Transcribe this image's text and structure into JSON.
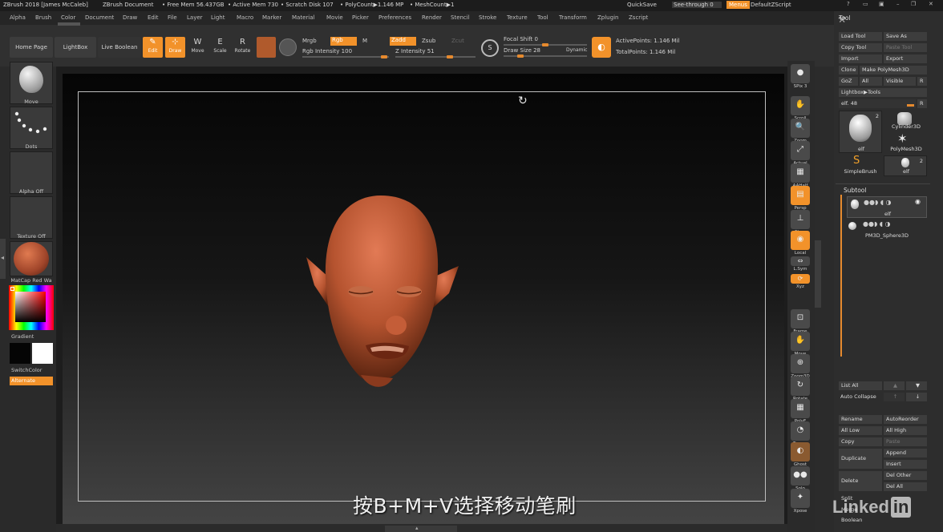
{
  "status_bar": {
    "app_title": "ZBrush 2018 [James McCaleb]",
    "document": "ZBrush Document",
    "free_mem": "• Free Mem 56.437GB",
    "active_mem": "• Active Mem 730",
    "scratch_disk": "• Scratch Disk 107",
    "polycount": "• PolyCount▶1.146 MP",
    "meshcount": "• MeshCount▶1",
    "quicksave": "QuickSave",
    "see_through": "See-through  0",
    "menus": "Menus",
    "script": "DefaultZScript"
  },
  "menus": [
    "Alpha",
    "Brush",
    "Color",
    "Document",
    "Draw",
    "Edit",
    "File",
    "Layer",
    "Light",
    "Macro",
    "Marker",
    "Material",
    "Movie",
    "Picker",
    "Preferences",
    "Render",
    "Stencil",
    "Stroke",
    "Texture",
    "Tool",
    "Transform",
    "Zplugin",
    "Zscript"
  ],
  "toolbar": {
    "home_page": "Home Page",
    "lightbox": "LightBox",
    "live_boolean": "Live Boolean",
    "edit": "Edit",
    "draw": "Draw",
    "move": "Move",
    "scale": "Scale",
    "rotate": "Rotate",
    "mrgb": "Mrgb",
    "rgb": "Rgb",
    "m": "M",
    "zadd": "Zadd",
    "zsub": "Zsub",
    "zcut": "Zcut",
    "rgb_intensity": "Rgb Intensity 100",
    "z_intensity": "Z Intensity 51",
    "focal_shift": "Focal Shift 0",
    "draw_size": "Draw Size 28",
    "dynamic": "Dynamic",
    "active_points": "ActivePoints: 1.146 Mil",
    "total_points": "TotalPoints: 1.146 Mil"
  },
  "left_tray": {
    "brush": "Move",
    "stroke": "Dots",
    "alpha": "Alpha Off",
    "texture": "Texture Off",
    "material": "MatCap Red Wa",
    "gradient": "Gradient",
    "switch_color": "SwitchColor",
    "alternate": "Alternate"
  },
  "right_shelf": [
    {
      "label": "SPix 3"
    },
    {
      "label": "Scroll"
    },
    {
      "label": "Zoom"
    },
    {
      "label": "Actual"
    },
    {
      "label": "AAHalf"
    },
    {
      "label": "Persp"
    },
    {
      "label": "Floor"
    },
    {
      "label": "Local"
    },
    {
      "label": "L.Sym"
    },
    {
      "label": "Xyz"
    },
    {
      "label": "Frame"
    },
    {
      "label": "Move"
    },
    {
      "label": "Zoom3D"
    },
    {
      "label": "Rotate"
    },
    {
      "label": "PolyF"
    },
    {
      "label": "Transp"
    },
    {
      "label": "Ghost"
    },
    {
      "label": "Solo"
    },
    {
      "label": "Xpose"
    }
  ],
  "tool_panel": {
    "title": "Tool",
    "load_tool": "Load Tool",
    "save_as": "Save As",
    "copy_tool": "Copy Tool",
    "paste_tool": "Paste Tool",
    "import": "Import",
    "export": "Export",
    "clone": "Clone",
    "make_polymesh": "Make PolyMesh3D",
    "goz": "GoZ",
    "all": "All",
    "visible": "Visible",
    "r": "R",
    "lightbox_tools": "Lightbox▶Tools",
    "tool_slider": "elf. 48",
    "thumb_elf": "elf",
    "thumb_elf_count": "2",
    "thumb_cylinder": "Cylinder3D",
    "thumb_polymesh": "PolyMesh3D",
    "thumb_simplebrush": "SimpleBrush",
    "thumb_elf2": "elf",
    "thumb_elf2_count": "2",
    "subtool_title": "Subtool",
    "subtool_1": "elf",
    "subtool_2": "PM3D_Sphere3D",
    "list_all": "List All",
    "auto_collapse": "Auto Collapse",
    "rename": "Rename",
    "autoreorder": "AutoReorder",
    "all_low": "All Low",
    "all_high": "All High",
    "copy": "Copy",
    "paste": "Paste",
    "duplicate": "Duplicate",
    "append": "Append",
    "insert": "Insert",
    "delete": "Delete",
    "del_other": "Del Other",
    "del_all": "Del All",
    "split": "Split",
    "merge": "Merge",
    "boolean": "Boolean"
  },
  "subtitle": "按B+M+V选择移动笔刷",
  "watermark": "Linked"
}
